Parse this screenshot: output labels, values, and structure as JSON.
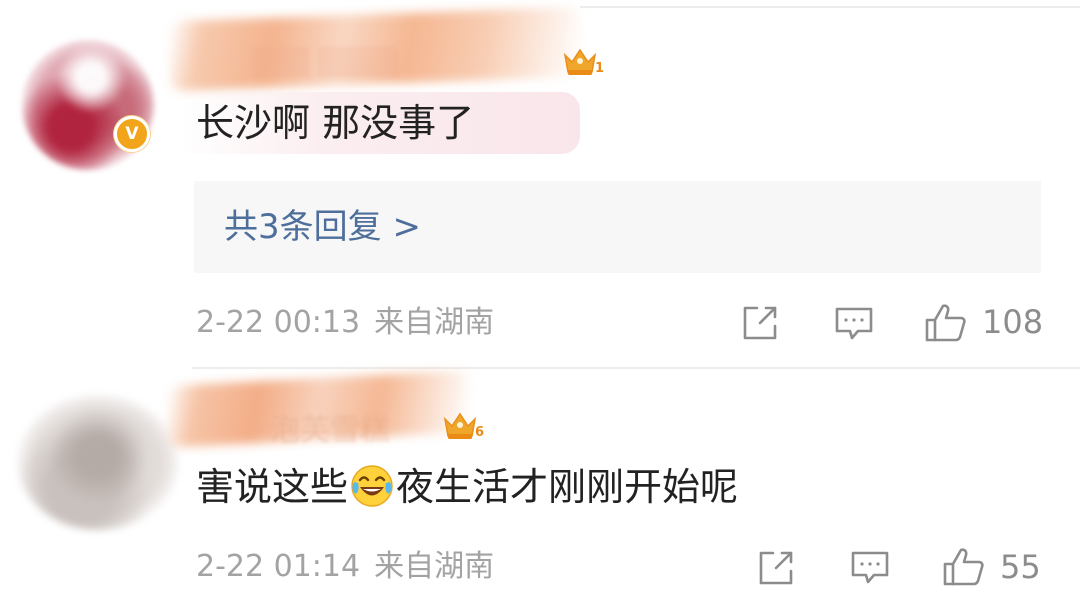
{
  "comments": [
    {
      "text": "长沙啊 那没事了",
      "vip_badge": "V",
      "level": "1",
      "replies_label": "共3条回复 >",
      "date": "2-22 00:13",
      "location": "来自湖南",
      "likes": "108"
    },
    {
      "author_visible": "泡芙雪糕",
      "text_before_emoji": "害说这些",
      "emoji": "tears-of-joy-emoji",
      "text_after_emoji": "夜生活才刚刚开始呢",
      "level": "6",
      "date": "2-22 01:14",
      "location": "来自湖南",
      "likes": "55"
    }
  ],
  "icons": {
    "share": "share-icon",
    "comment": "comment-icon",
    "like": "thumbs-up-icon",
    "level": "crown-icon"
  },
  "colors": {
    "link": "#4e6e9b",
    "meta": "#a3a3a3",
    "icon": "#8c8c8c",
    "vip": "#f2a51a",
    "crown": "#f0a62a"
  }
}
